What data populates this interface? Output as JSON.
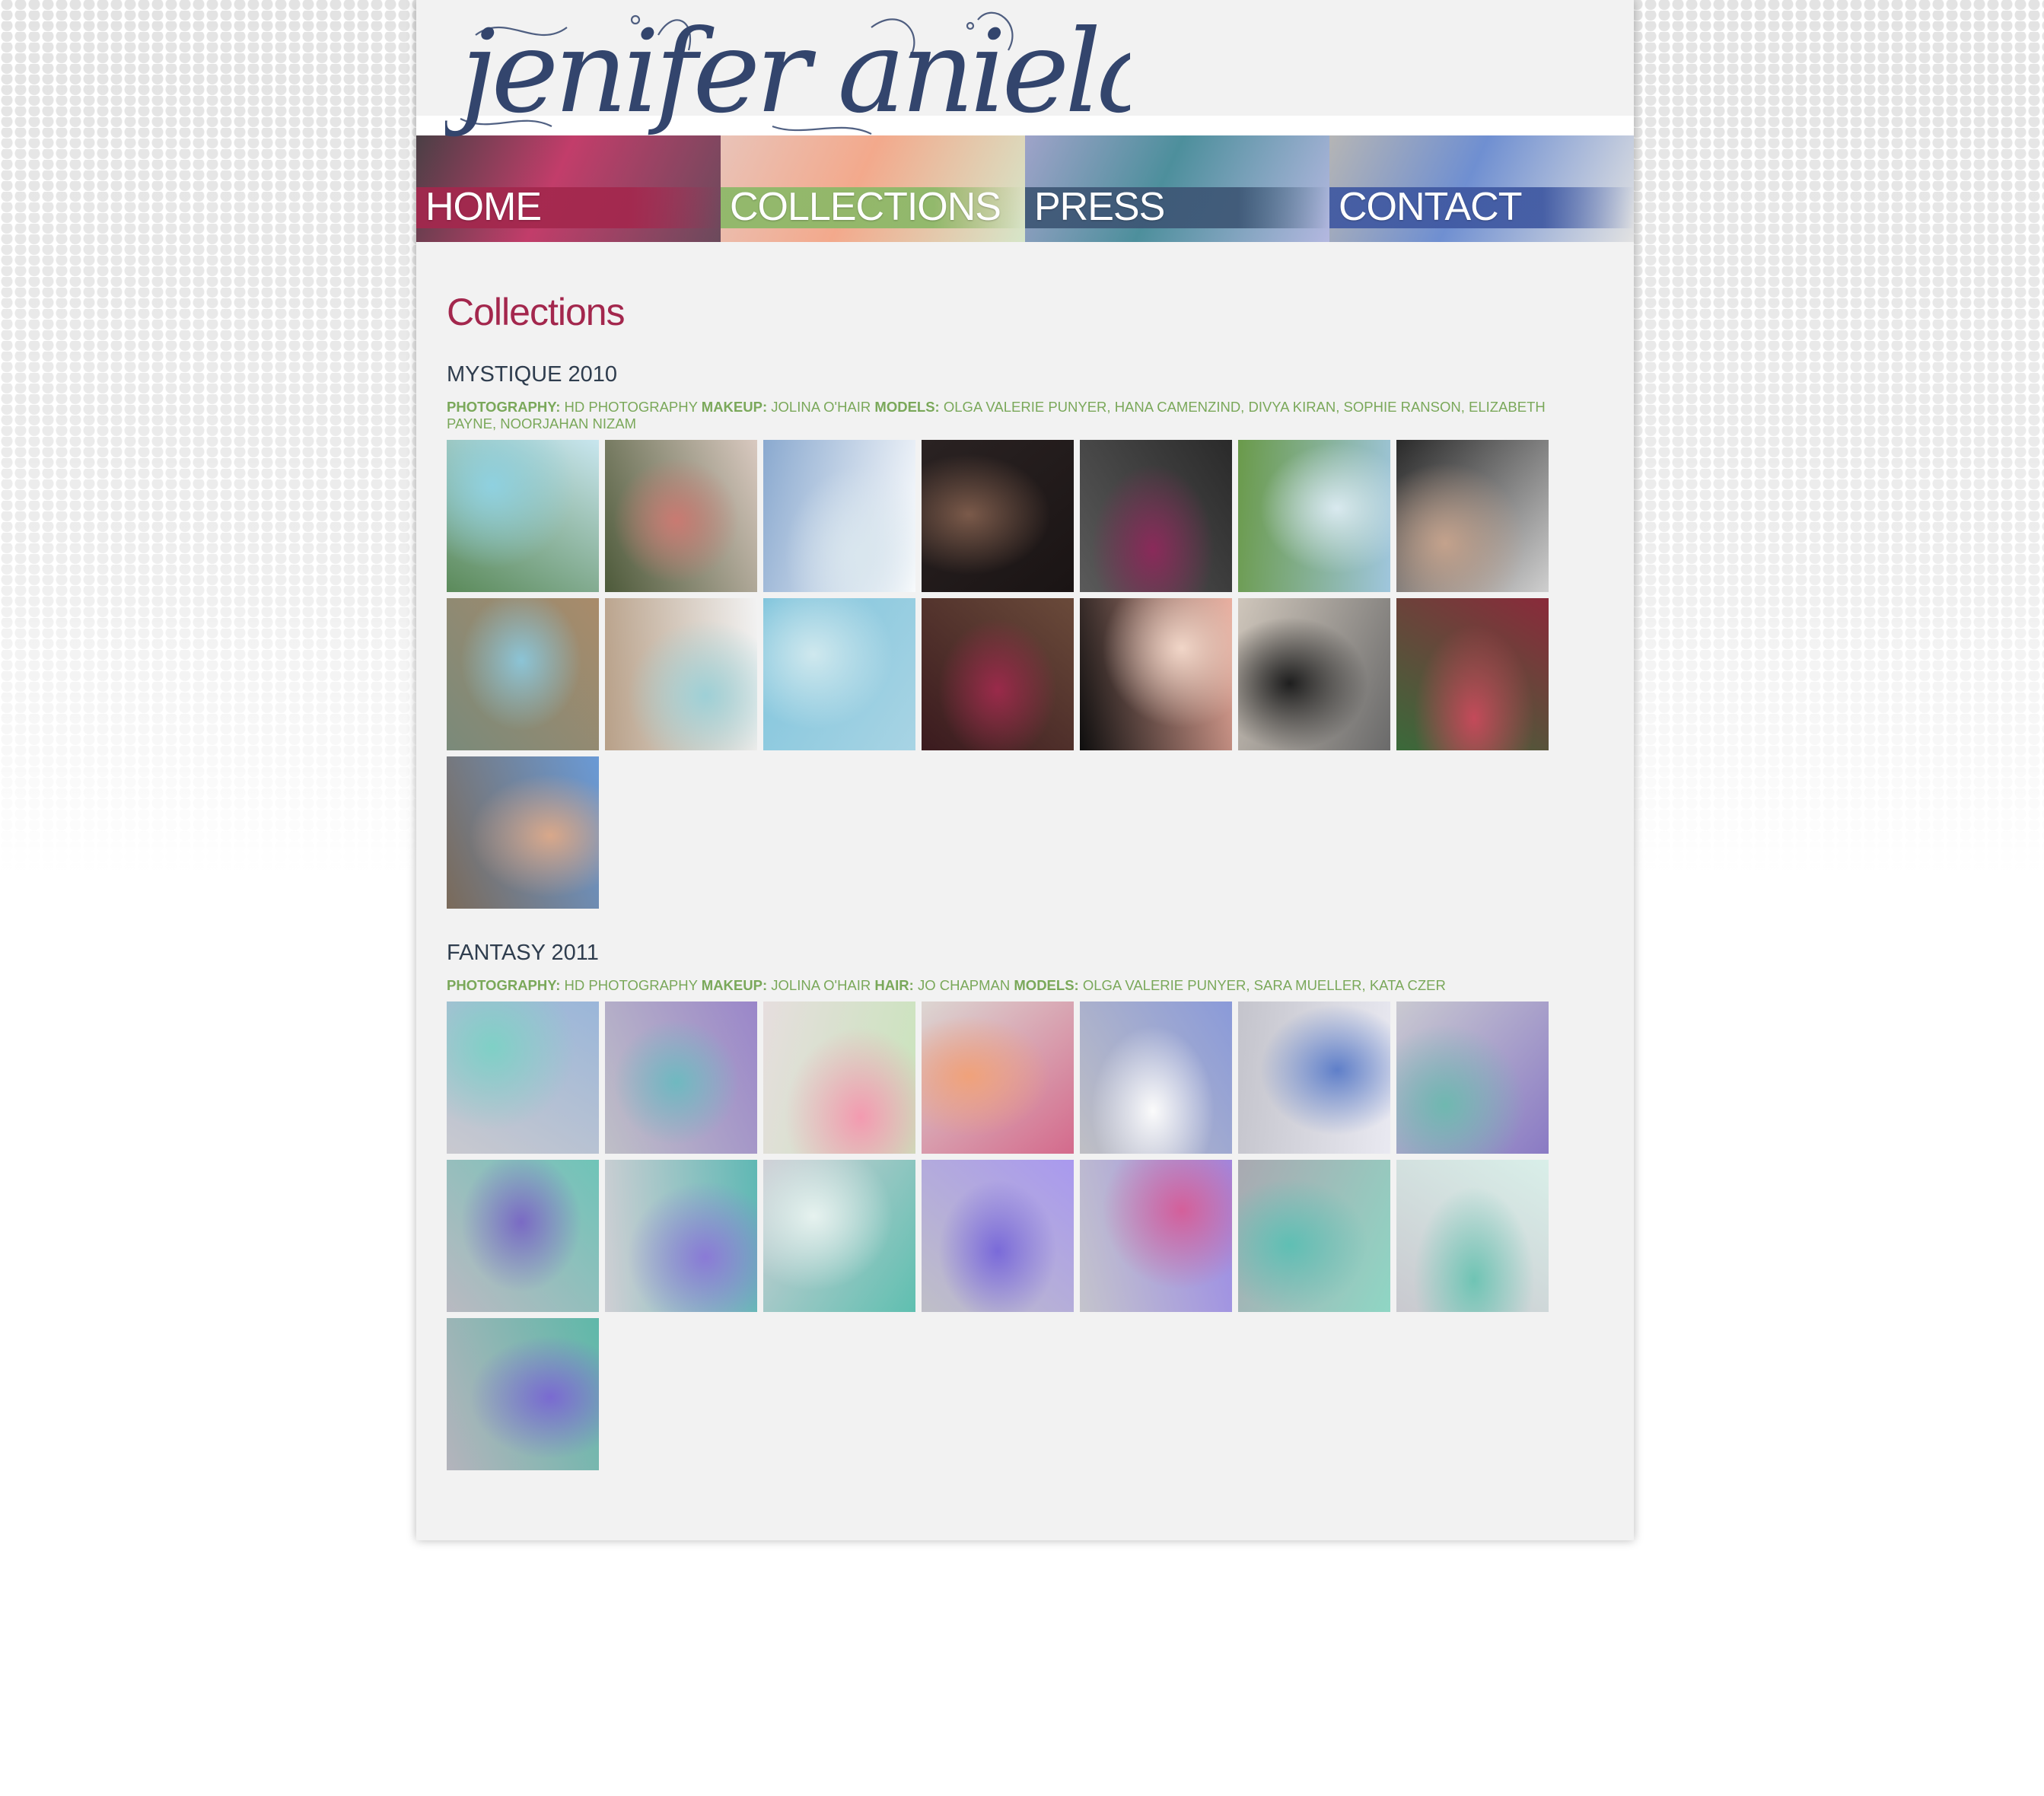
{
  "site": {
    "logo_text": "jenifer aniela"
  },
  "nav": {
    "items": [
      {
        "label": "HOME",
        "band": "#a3274d",
        "bg1": "#4a3f45",
        "bg2": "#c23d6a",
        "bg3": "#6b4a5c"
      },
      {
        "label": "COLLECTIONS",
        "band": "#8bb867",
        "bg1": "#e9c3b8",
        "bg2": "#f3a98c",
        "bg3": "#d6e6c9"
      },
      {
        "label": "PRESS",
        "band": "#3d5675",
        "bg1": "#9fa3c9",
        "bg2": "#4d8f9c",
        "bg3": "#b4b8e0"
      },
      {
        "label": "CONTACT",
        "band": "#3f58a1",
        "bg1": "#b5b5b5",
        "bg2": "#6f8fd1",
        "bg3": "#e2e2e2"
      }
    ]
  },
  "page": {
    "title": "Collections"
  },
  "collections": [
    {
      "title": "MYSTIQUE 2010",
      "credits": [
        {
          "label": "PHOTOGRAPHY:",
          "value": "HD PHOTOGRAPHY"
        },
        {
          "label": "MAKEUP:",
          "value": "JOLINA O'HAIR"
        },
        {
          "label": "MODELS:",
          "value": "OLGA VALERIE PUNYER, HANA CAMENZIND, DIVYA KIRAN, SOPHIE RANSON, ELIZABETH PAYNE, NOORJAHAN NIZAM"
        }
      ],
      "photos": [
        {
          "c1": "#5b8a5a",
          "c2": "#8fd1e0",
          "c3": "#c8e6ef"
        },
        {
          "c1": "#4d5a3a",
          "c2": "#c97a72",
          "c3": "#d9c9c0"
        },
        {
          "c1": "#8aa9cf",
          "c2": "#d9e6ee",
          "c3": "#ffffff"
        },
        {
          "c1": "#2a2222",
          "c2": "#7b5a4a",
          "c3": "#1a1414"
        },
        {
          "c1": "#5a5a5a",
          "c2": "#8a2a5a",
          "c3": "#2a2a2a"
        },
        {
          "c1": "#6a9a4a",
          "c2": "#d9e9ef",
          "c3": "#9fc6dd"
        },
        {
          "c1": "#2a2a2a",
          "c2": "#c4a28c",
          "c3": "#cfcfcf"
        },
        {
          "c1": "#7a8a7a",
          "c2": "#8cc4d6",
          "c3": "#a98b6a"
        },
        {
          "c1": "#b8a088",
          "c2": "#9ed0d6",
          "c3": "#f2f2f2"
        },
        {
          "c1": "#7fc4dc",
          "c2": "#cfe8ee",
          "c3": "#a8d4e4"
        },
        {
          "c1": "#3a1a1e",
          "c2": "#9a2a4a",
          "c3": "#6a4a3a"
        },
        {
          "c1": "#0e0e0e",
          "c2": "#f1d6c8",
          "c3": "#e9a99a"
        },
        {
          "c1": "#cfc6bb",
          "c2": "#1e1e1e",
          "c3": "#6a6a6a"
        },
        {
          "c1": "#3a6a3a",
          "c2": "#c44a5a",
          "c3": "#8a2a3a"
        },
        {
          "c1": "#7a6a5a",
          "c2": "#d9a88a",
          "c3": "#6a9ad6"
        }
      ]
    },
    {
      "title": "FANTASY 2011",
      "credits": [
        {
          "label": "PHOTOGRAPHY:",
          "value": "HD PHOTOGRAPHY"
        },
        {
          "label": "MAKEUP:",
          "value": "JOLINA O'HAIR"
        },
        {
          "label": "HAIR:",
          "value": "JO CHAPMAN"
        },
        {
          "label": "MODELS:",
          "value": "OLGA VALERIE PUNYER, SARA MUELLER, KATA CZER"
        }
      ],
      "photos": [
        {
          "c1": "#c9c9cf",
          "c2": "#7fd0c6",
          "c3": "#9ab6d9"
        },
        {
          "c1": "#bfbfc7",
          "c2": "#6fb9c0",
          "c3": "#9a86c9"
        },
        {
          "c1": "#e6dede",
          "c2": "#f39ab0",
          "c3": "#c8e4ba"
        },
        {
          "c1": "#dcd6d2",
          "c2": "#f0a27a",
          "c3": "#d46a8c"
        },
        {
          "c1": "#bfbfc4",
          "c2": "#fbfbfb",
          "c3": "#8a9ad9"
        },
        {
          "c1": "#c4c4cc",
          "c2": "#5f7fc9",
          "c3": "#e9e9f1"
        },
        {
          "c1": "#c9c9d1",
          "c2": "#6fb8b0",
          "c3": "#8a7ac4"
        },
        {
          "c1": "#b9b9c1",
          "c2": "#7a6ac4",
          "c3": "#6fc4b8"
        },
        {
          "c1": "#cfcfd4",
          "c2": "#8a7ad6",
          "c3": "#5fb8b4"
        },
        {
          "c1": "#cfcfd6",
          "c2": "#e6f2ef",
          "c3": "#5fbfb0"
        },
        {
          "c1": "#bfbfc7",
          "c2": "#7a6ad9",
          "c3": "#a999ef"
        },
        {
          "c1": "#c4c4cc",
          "c2": "#d45f9a",
          "c3": "#9a8ae6"
        },
        {
          "c1": "#a9a9b1",
          "c2": "#5fbfb4",
          "c3": "#8fd6c4"
        },
        {
          "c1": "#c9c9cf",
          "c2": "#6fc4b4",
          "c3": "#d9efe9"
        },
        {
          "c1": "#b4b4bc",
          "c2": "#7a6ad1",
          "c3": "#5fb8a9"
        }
      ]
    }
  ]
}
